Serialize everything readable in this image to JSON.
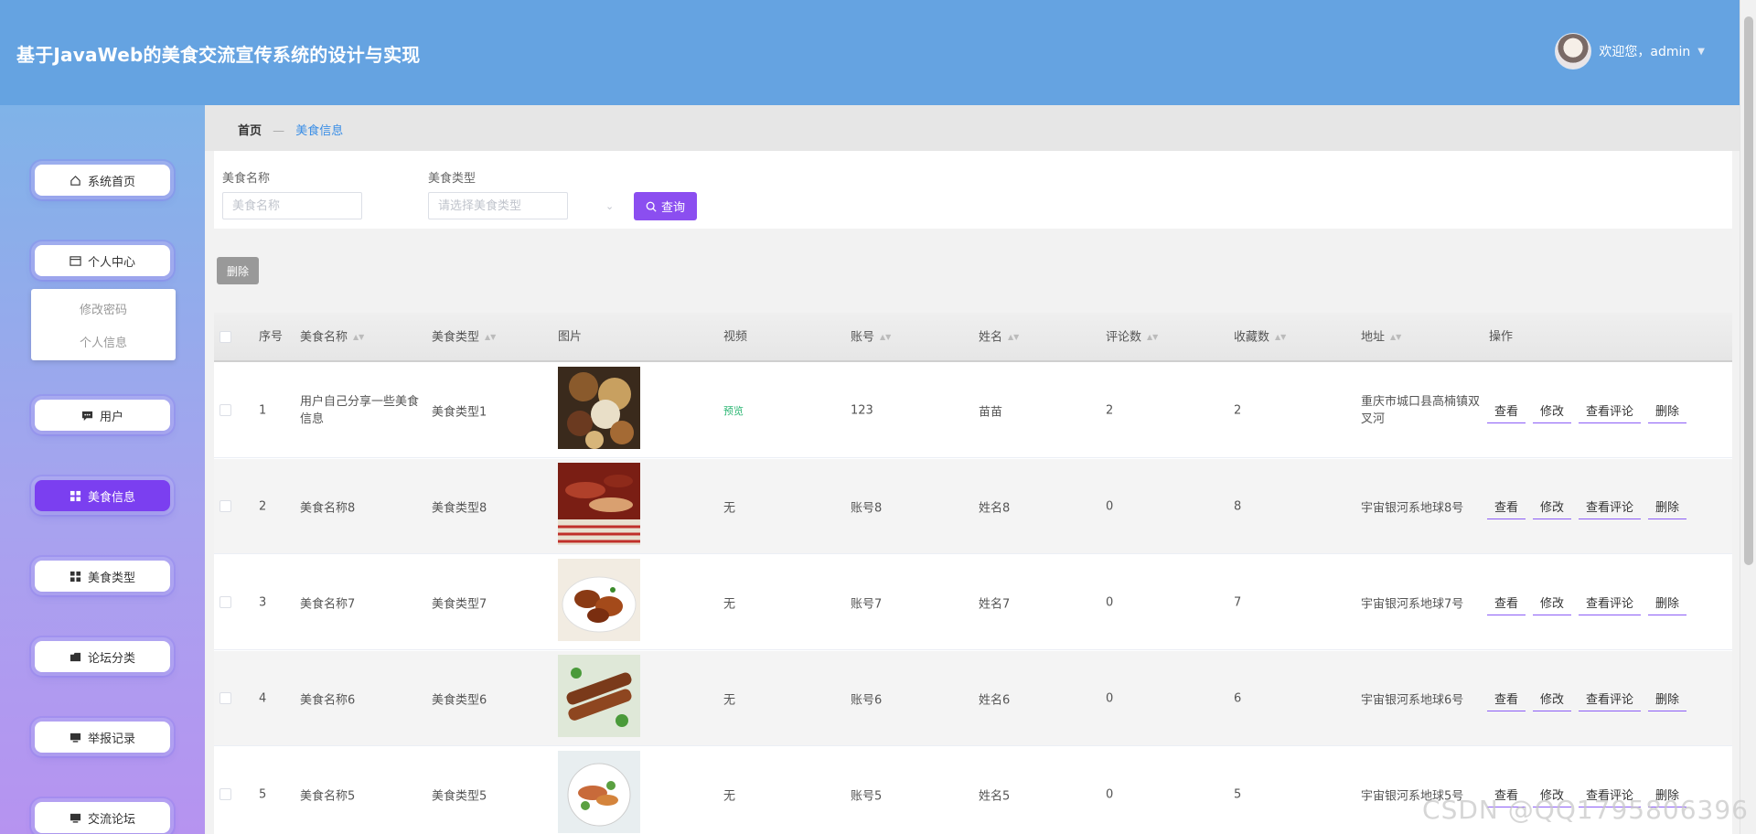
{
  "header": {
    "title": "基于JavaWeb的美食交流宣传系统的设计与实现",
    "welcome": "欢迎您，admin"
  },
  "sidebar": {
    "items": [
      {
        "label": "系统首页",
        "icon": "home-icon"
      },
      {
        "label": "个人中心",
        "icon": "id-card-icon"
      },
      {
        "label": "用户",
        "icon": "chat-icon"
      },
      {
        "label": "美食信息",
        "icon": "grid-icon",
        "active": true
      },
      {
        "label": "美食类型",
        "icon": "grid-icon"
      },
      {
        "label": "论坛分类",
        "icon": "folder-icon"
      },
      {
        "label": "举报记录",
        "icon": "monitor-icon"
      },
      {
        "label": "交流论坛",
        "icon": "monitor-icon"
      }
    ],
    "submenu": [
      "修改密码",
      "个人信息"
    ]
  },
  "breadcrumb": {
    "home": "首页",
    "sep": "—",
    "current": "美食信息"
  },
  "search": {
    "name_label": "美食名称",
    "name_placeholder": "美食名称",
    "type_label": "美食类型",
    "type_placeholder": "请选择美食类型",
    "button": "查询"
  },
  "toolbar": {
    "delete": "删除"
  },
  "table": {
    "headers": [
      "序号",
      "美食名称",
      "美食类型",
      "图片",
      "视频",
      "账号",
      "姓名",
      "评论数",
      "收藏数",
      "地址",
      "操作"
    ],
    "rows": [
      {
        "index": "1",
        "name": "用户自己分享一些美食信息",
        "type": "美食类型1",
        "video": "预览",
        "account": "123",
        "person": "苗苗",
        "comments": "2",
        "favorites": "2",
        "address": "重庆市城口县高楠镇双叉河",
        "img": "food-cheese"
      },
      {
        "index": "2",
        "name": "美食名称8",
        "type": "美食类型8",
        "video": "无",
        "account": "账号8",
        "person": "姓名8",
        "comments": "0",
        "favorites": "8",
        "address": "宇宙银河系地球8号",
        "img": "food-sausage"
      },
      {
        "index": "3",
        "name": "美食名称7",
        "type": "美食类型7",
        "video": "无",
        "account": "账号7",
        "person": "姓名7",
        "comments": "0",
        "favorites": "7",
        "address": "宇宙银河系地球7号",
        "img": "food-wings"
      },
      {
        "index": "4",
        "name": "美食名称6",
        "type": "美食类型6",
        "video": "无",
        "account": "账号6",
        "person": "姓名6",
        "comments": "0",
        "favorites": "6",
        "address": "宇宙银河系地球6号",
        "img": "food-skewer"
      },
      {
        "index": "5",
        "name": "美食名称5",
        "type": "美食类型5",
        "video": "无",
        "account": "账号5",
        "person": "姓名5",
        "comments": "0",
        "favorites": "5",
        "address": "宇宙银河系地球5号",
        "img": "food-salad"
      }
    ],
    "ops": [
      "查看",
      "修改",
      "查看评论",
      "删除"
    ]
  },
  "watermark": "CSDN @QQ1795806396",
  "colors": {
    "header": "#65a3e1",
    "accent": "#8b4ef0",
    "active_menu": "#7b3ff0",
    "preview_link": "#2bb673"
  }
}
